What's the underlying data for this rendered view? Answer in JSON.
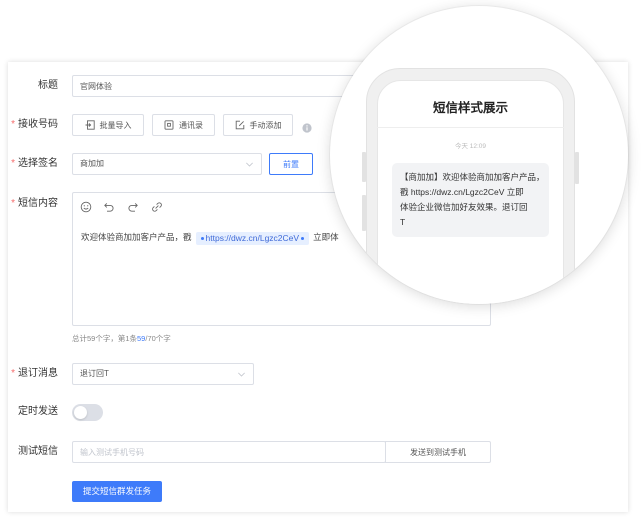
{
  "colors": {
    "accent": "#3e7bfa",
    "required": "#f56c6c"
  },
  "form": {
    "required_mark": "*",
    "title": {
      "label": "标题",
      "value": "官网体验"
    },
    "recipients": {
      "label": "接收号码",
      "buttons": {
        "import": {
          "label": "批量导入",
          "icon": "import-icon"
        },
        "contacts": {
          "label": "通讯录",
          "icon": "contacts-icon"
        },
        "manual": {
          "label": "手动添加",
          "icon": "edit-icon"
        }
      },
      "help_icon": "info-icon"
    },
    "signature": {
      "label": "选择签名",
      "value": "商加加",
      "position_button": "前置"
    },
    "content": {
      "label": "短信内容",
      "toolbar": [
        "emoji-icon",
        "undo-icon",
        "redo-icon",
        "link-icon"
      ],
      "text_before": "欢迎体验商加加客户产品，戳",
      "link": "https://dwz.cn/Lgzc2CeV",
      "text_after": "立即体",
      "counter": {
        "prefix": "总计59个字，第1条",
        "current": "59",
        "suffix": "/70个字"
      }
    },
    "unsubscribe": {
      "label": "退订消息",
      "value": "退订回T"
    },
    "schedule": {
      "label": "定时发送",
      "enabled": false
    },
    "test_sms": {
      "label": "测试短信",
      "placeholder": "输入测试手机号码",
      "button": "发送到测试手机"
    },
    "submit_button": "提交短信群发任务"
  },
  "preview": {
    "title": "短信样式展示",
    "timestamp": "今天 12:09",
    "message_lines": [
      "【商加加】欢迎体验商加加客户产品，",
      "戳 https://dwz.cn/Lgzc2CeV 立即",
      "体验企业微信加好友效果。退订回",
      "T"
    ]
  }
}
